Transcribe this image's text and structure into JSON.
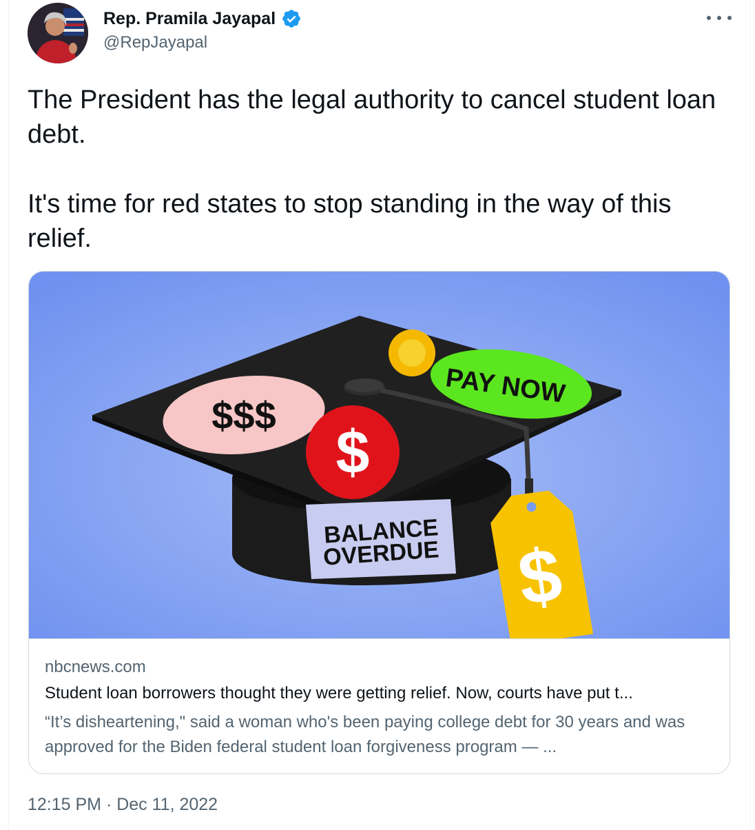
{
  "author": {
    "display_name": "Rep. Pramila Jayapal",
    "handle": "@RepJayapal",
    "verified": true,
    "verified_icon": "verified-badge-icon",
    "verified_color": "#1d9bf0"
  },
  "tweet": {
    "text_lines": [
      "The President has the legal authority to cancel student loan debt.",
      "It's time for red states to stop standing in the way of this relief."
    ],
    "timestamp": "12:15 PM · Dec 11, 2022"
  },
  "card": {
    "image": {
      "stickers": {
        "money": "$$$",
        "dollar": "$",
        "pay_now": "PAY NOW",
        "balance_line1": "BALANCE",
        "balance_line2": "OVERDUE",
        "tag_dollar": "$"
      }
    },
    "domain": "nbcnews.com",
    "title": "Student loan borrowers thought they were getting relief. Now, courts have put t...",
    "description": "“It’s disheartening,\" said a woman who's been paying college debt for 30 years and was approved for the Biden federal student loan forgiveness program — ..."
  },
  "colors": {
    "text_primary": "#0f1419",
    "text_secondary": "#536471",
    "border": "#cfd9de",
    "card_background": "#7a9cf0"
  }
}
